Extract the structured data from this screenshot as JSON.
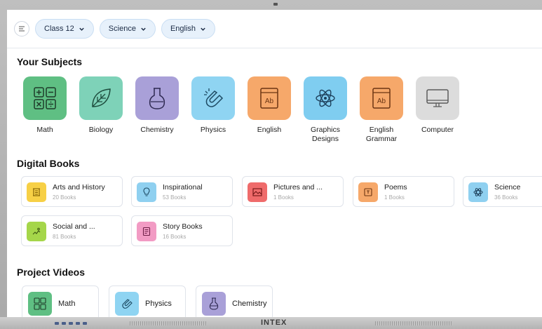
{
  "filters": [
    {
      "label": "Class 12"
    },
    {
      "label": "Science"
    },
    {
      "label": "English"
    }
  ],
  "sections": {
    "subjects": "Your Subjects",
    "books": "Digital Books",
    "videos": "Project Videos"
  },
  "subjects": [
    {
      "label": "Math",
      "icon": "calculator-icon",
      "color": "#5fbf83"
    },
    {
      "label": "Biology",
      "icon": "leaf-icon",
      "color": "#7ed2b8"
    },
    {
      "label": "Chemistry",
      "icon": "flask-icon",
      "color": "#a9a0d8"
    },
    {
      "label": "Physics",
      "icon": "magnet-icon",
      "color": "#8fd4f2"
    },
    {
      "label": "English",
      "icon": "ab-book-icon",
      "color": "#f6a86a"
    },
    {
      "label": "Graphics Designs",
      "icon": "atom-icon",
      "color": "#7fcdf0"
    },
    {
      "label": "English Grammar",
      "icon": "ab-book-icon",
      "color": "#f6a86a"
    },
    {
      "label": "Computer",
      "icon": "monitor-icon",
      "color": "#dcdcdc"
    }
  ],
  "books": [
    {
      "title": "Arts and History",
      "count": "20 Books",
      "icon": "scroll-icon",
      "color": "#f7d046"
    },
    {
      "title": "Inspirational",
      "count": "53 Books",
      "icon": "bulb-icon",
      "color": "#8fd0f0"
    },
    {
      "title": "Pictures and ...",
      "count": "1 Books",
      "icon": "picture-icon",
      "color": "#ef6b6b"
    },
    {
      "title": "Poems",
      "count": "1 Books",
      "icon": "poem-icon",
      "color": "#f6a86a"
    },
    {
      "title": "Science",
      "count": "36 Books",
      "icon": "atom-icon",
      "color": "#8fd0f0"
    },
    {
      "title": "Social and ...",
      "count": "81 Books",
      "icon": "social-icon",
      "color": "#a5d64a"
    },
    {
      "title": "Story Books",
      "count": "16 Books",
      "icon": "story-icon",
      "color": "#f29bc4"
    }
  ],
  "videos": [
    {
      "label": "Math",
      "icon": "calculator-icon",
      "color": "#5fbf83"
    },
    {
      "label": "Physics",
      "icon": "magnet-icon",
      "color": "#8fd4f2"
    },
    {
      "label": "Chemistry",
      "icon": "flask-icon",
      "color": "#a9a0d8"
    }
  ],
  "device": {
    "brand": "INTEX"
  }
}
